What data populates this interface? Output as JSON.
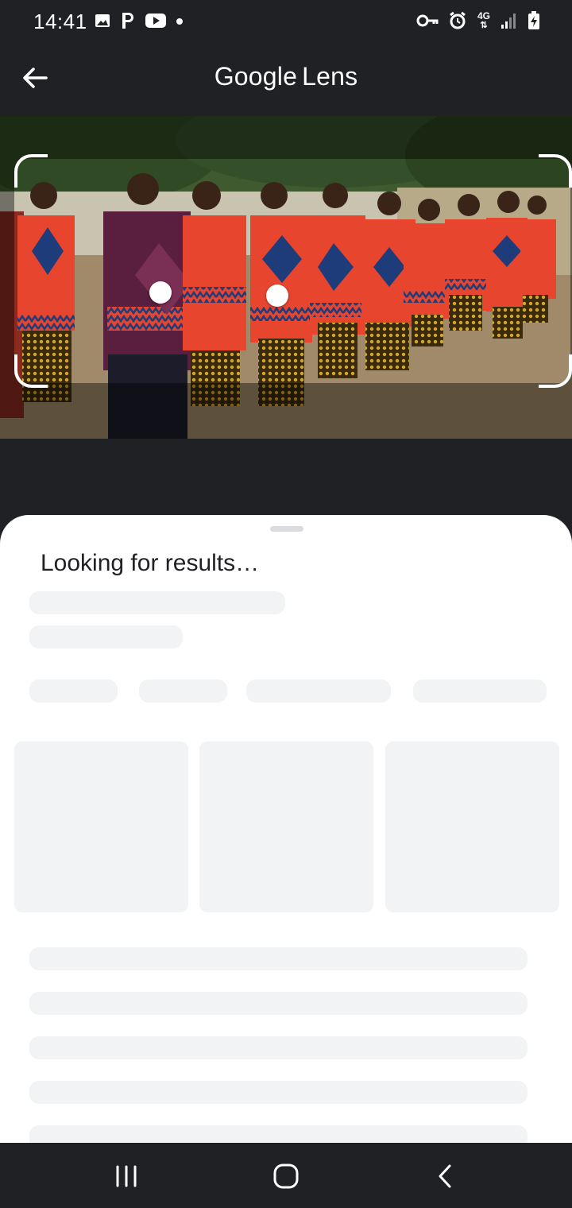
{
  "status_bar": {
    "time": "14:41",
    "left_icons": [
      "gallery-icon",
      "parking-icon",
      "youtube-icon",
      "dot-icon"
    ],
    "right_icons": [
      "vpn-key-icon",
      "alarm-icon",
      "network-4g-icon",
      "signal-icon",
      "battery-charging-icon"
    ],
    "network_label": "4G"
  },
  "app_bar": {
    "title_brand": "Google",
    "title_suffix": "Lens",
    "back_icon": "back-arrow-icon"
  },
  "photo": {
    "description_icons": [
      "selection-dot-icon",
      "selection-dot-icon"
    ]
  },
  "sheet": {
    "title": "Looking for results…"
  },
  "nav_bar": {
    "buttons": [
      "recent-apps-icon",
      "home-icon",
      "back-icon"
    ]
  },
  "colors": {
    "background_dark": "#202124",
    "sheet": "#ffffff",
    "placeholder": "#f1f3f4",
    "dress_red": "#e8452e",
    "dress_blue": "#2a4d8f",
    "wrap_purple": "#5a1f3f"
  }
}
